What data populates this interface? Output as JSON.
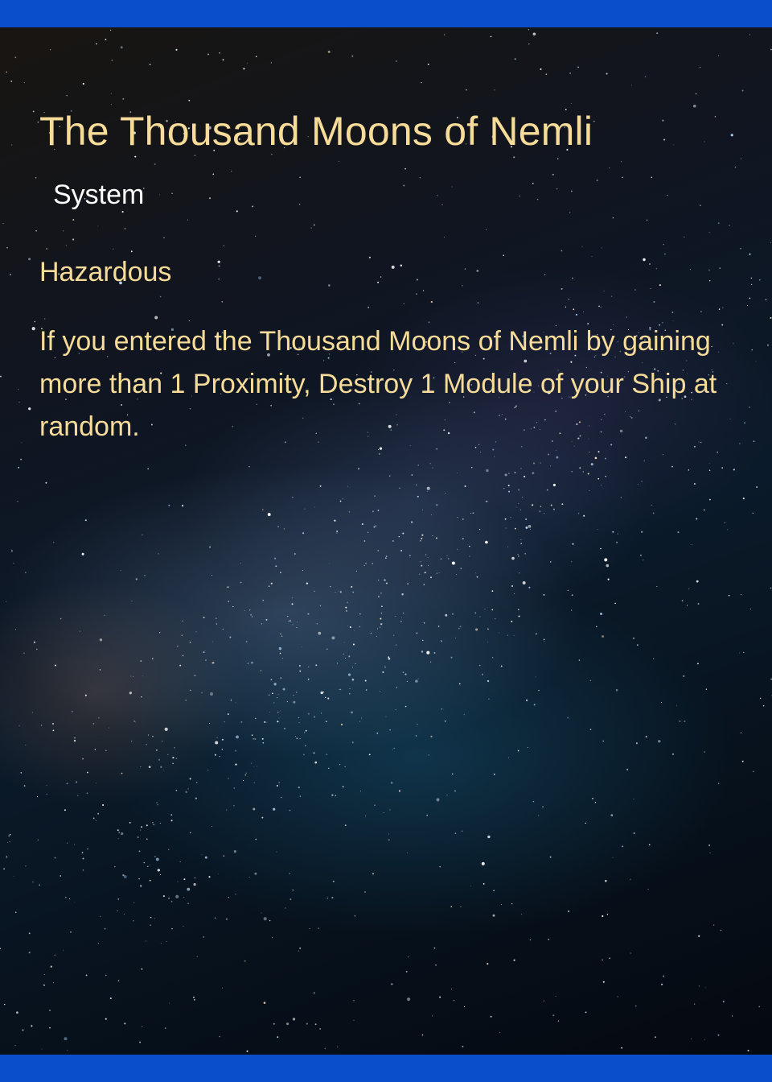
{
  "card": {
    "title": "The Thousand Moons of Nemli",
    "type": "System",
    "keyword": "Hazardous",
    "rules_text": "If you entered the Thousand Moons of Nemli by gaining more than 1 Proximity, Destroy 1 Module of your Ship at random."
  },
  "colors": {
    "title_text": "#f6dc98",
    "subtitle_text": "#ffffff",
    "band": "#0a4ecc"
  }
}
